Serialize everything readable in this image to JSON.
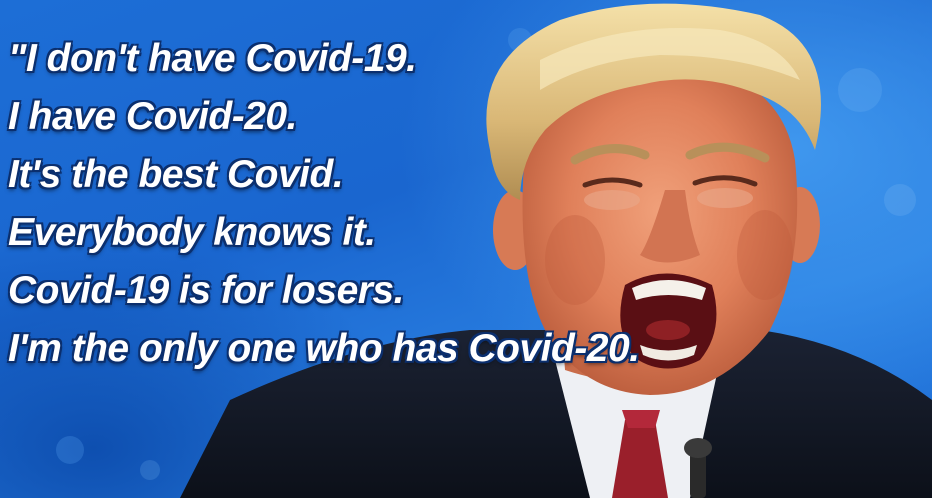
{
  "meme": {
    "quote_lines": [
      "\"I don't have Covid-19.",
      "I have Covid-20.",
      "It's the best Covid.",
      "Everybody knows it.",
      "Covid-19 is for losers.",
      "I'm the only one who has Covid-20."
    ],
    "text_color": "#ffffff",
    "background_color": "#1a66cf",
    "photo_subject": "shouting-man-photo"
  }
}
